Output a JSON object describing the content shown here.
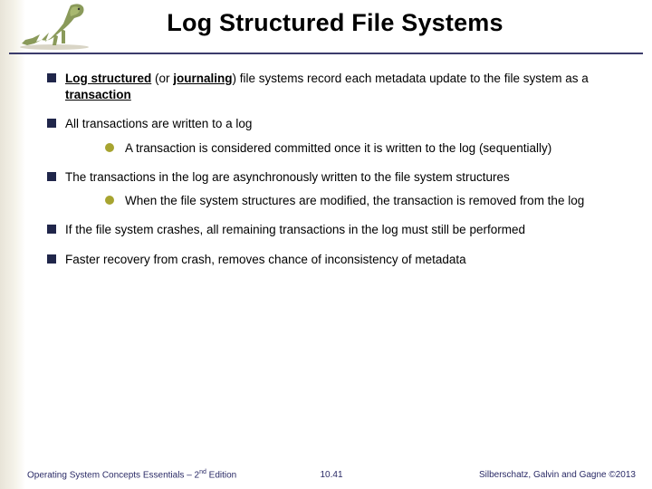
{
  "title": "Log Structured File Systems",
  "bullets": {
    "b1_pre": "Log structured",
    "b1_mid": " (or ",
    "b1_journ": "journaling",
    "b1_post1": ") file systems record each metadata update to the file system as a ",
    "b1_trans": "transaction",
    "b2": "All transactions are written to a log",
    "b2_sub": "A transaction is considered committed once it is written to the log (sequentially)",
    "b3": "The transactions in the log are asynchronously written to the file system structures",
    "b3_sub": "When the file system structures are modified, the transaction is removed from the log",
    "b4": "If the file system crashes, all remaining transactions in the log must still be performed",
    "b5": "Faster recovery from crash, removes chance of inconsistency of metadata"
  },
  "footer": {
    "left_a": "Operating System Concepts Essentials – 2",
    "left_b": "nd",
    "left_c": " Edition",
    "mid": "10.41",
    "right": "Silberschatz, Galvin and Gagne ©2013"
  }
}
